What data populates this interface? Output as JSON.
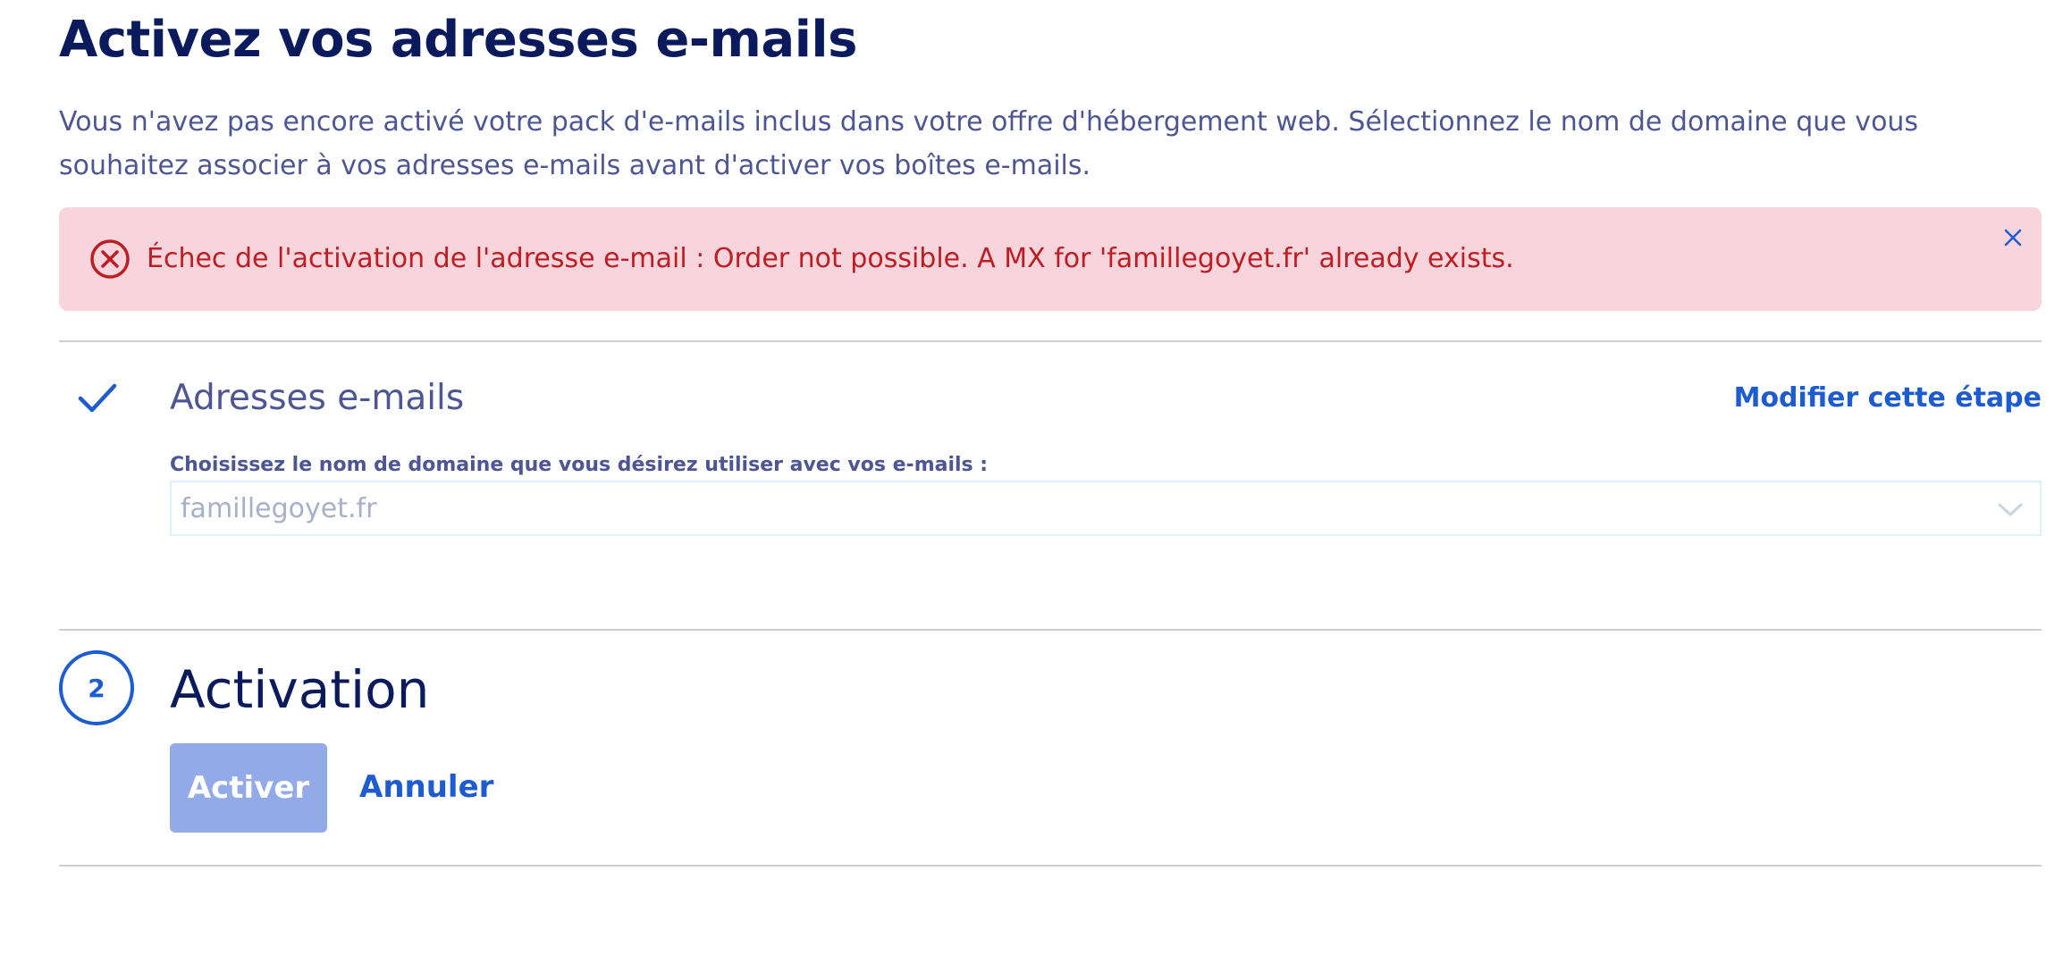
{
  "page": {
    "title": "Activez vos adresses e-mails",
    "intro": "Vous n'avez pas encore activé votre pack d'e-mails inclus dans votre offre d'hébergement web. Sélectionnez le nom de domaine que vous souhaitez associer à vos adresses e-mails avant d'activer vos boîtes e-mails."
  },
  "alert": {
    "type": "error",
    "message": "Échec de l'activation de l'adresse e-mail : Order not possible. A MX for 'famillegoyet.fr' already exists.",
    "icon": "error-circle-x-icon",
    "close_icon": "close-icon"
  },
  "step1": {
    "status": "completed",
    "status_icon": "check-icon",
    "title": "Adresses e-mails",
    "modify_label": "Modifier cette étape",
    "field_label": "Choisissez le nom de domaine que vous désirez utiliser avec vos e-mails :",
    "selected_domain": "famillegoyet.fr",
    "dropdown_icon": "chevron-down-icon"
  },
  "step2": {
    "number": "2",
    "title": "Activation",
    "activate_label": "Activer",
    "cancel_label": "Annuler"
  },
  "colors": {
    "heading": "#0a1a5c",
    "body_text": "#4d5693",
    "primary": "#1d5bd0",
    "error_bg": "#f8d4dc",
    "error_text": "#be1d22",
    "disabled_button": "#93aae9"
  }
}
